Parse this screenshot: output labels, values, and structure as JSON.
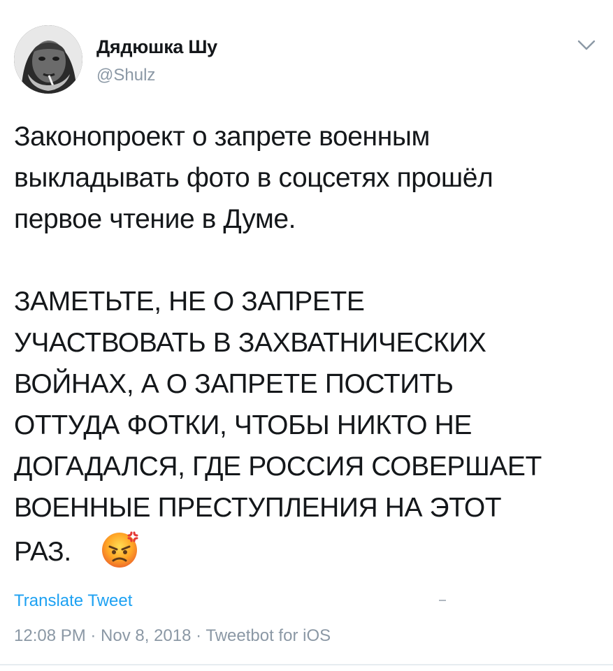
{
  "author": {
    "name": "Дядюшка Шу",
    "handle": "@Shulz"
  },
  "tweet": {
    "paragraph_1": "Законопроект о запрете военным\nвыкладывать фото в соцсетях прошёл\nпервое чтение в Думе.",
    "paragraph_2": "ЗАМЕТЬТЕ, НЕ О ЗАПРЕТЕ\nУЧАСТВОВАТЬ В ЗАХВАТНИЧЕСКИХ\nВОЙНАХ, А О ЗАПРЕТЕ ПОСТИТЬ\nОТТУДА ФОТКИ, ЧТОБЫ НИКТО НЕ\nДОГАДАЛСЯ, ГДЕ РОССИЯ СОВЕРШАЕТ\nВОЕННЫЕ ПРЕСТУПЛЕНИЯ НА ЭТОТ\nРАЗ.",
    "emoji": "angry-face-emoji"
  },
  "actions": {
    "translate_label": "Translate Tweet",
    "menu_icon": "chevron-down-icon"
  },
  "meta": {
    "line": "12:08 PM · Nov 8, 2018 · Tweetbot for iOS"
  },
  "colors": {
    "link": "#1da1f2",
    "secondary_text": "#8b98a5",
    "primary_text": "#14171a"
  }
}
